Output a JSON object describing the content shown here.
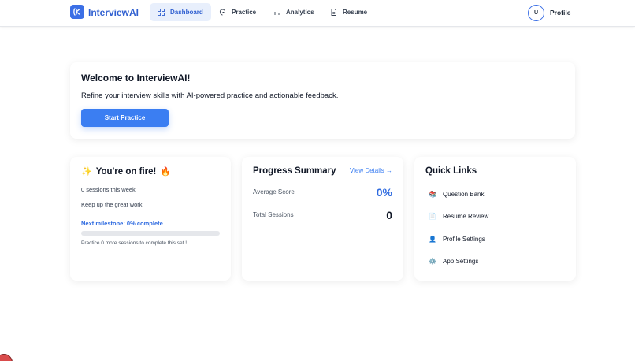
{
  "app": {
    "name": "InterviewAI"
  },
  "nav": {
    "items": [
      {
        "label": "Dashboard",
        "icon": "grid-icon"
      },
      {
        "label": "Practice",
        "icon": "brain-icon"
      },
      {
        "label": "Analytics",
        "icon": "bar-chart-icon"
      },
      {
        "label": "Resume",
        "icon": "document-icon"
      }
    ],
    "active": "Dashboard",
    "avatar_initial": "U",
    "profile_label": "Profile"
  },
  "welcome": {
    "title": "Welcome to InterviewAI!",
    "subtitle": "Refine your interview skills with AI-powered practice and actionable feedback.",
    "cta": "Start Practice"
  },
  "streak": {
    "sparkle": "✨",
    "title": "You're on fire!",
    "fire": "🔥",
    "sessions_text": "0 sessions this week",
    "encouragement": "Keep up the great work!",
    "milestone_text": "Next milestone: 0% complete",
    "milestone_percent": 0,
    "note": "Practice 0 more sessions to complete this set !"
  },
  "progress": {
    "title": "Progress Summary",
    "view_details": "View Details →",
    "metrics": [
      {
        "label": "Average Score",
        "value": "0%"
      },
      {
        "label": "Total Sessions",
        "value": "0"
      }
    ]
  },
  "quick_links": {
    "title": "Quick Links",
    "items": [
      {
        "label": "Question Bank",
        "icon": "📚"
      },
      {
        "label": "Resume Review",
        "icon": "📄"
      },
      {
        "label": "Profile Settings",
        "icon": "👤"
      },
      {
        "label": "App Settings",
        "icon": "⚙️"
      }
    ]
  },
  "colors": {
    "primary": "#3b7ef2",
    "brand": "#2f5fd0",
    "active_nav_bg": "#e8effc"
  }
}
